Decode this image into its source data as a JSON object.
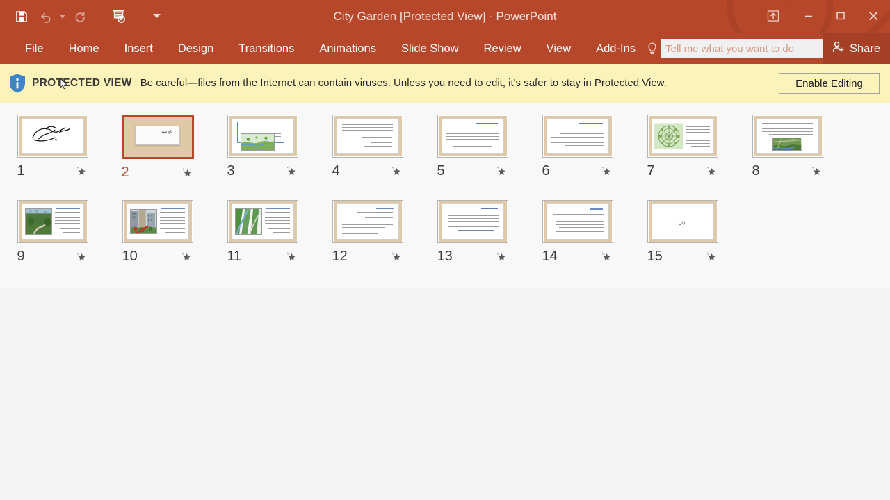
{
  "window": {
    "title": "City Garden [Protected View] - PowerPoint",
    "accent_color": "#b7472a",
    "share_bg": "#a53f25"
  },
  "quick_access": {
    "items": [
      {
        "name": "save-icon",
        "label": "Save"
      },
      {
        "name": "undo-icon",
        "label": "Undo"
      },
      {
        "name": "undo-dropdown-icon",
        "label": "Undo options"
      },
      {
        "name": "redo-icon",
        "label": "Redo"
      },
      {
        "name": "start-presentation-icon",
        "label": "Start From Beginning"
      },
      {
        "name": "customize-qat-icon",
        "label": "Customize Quick Access Toolbar"
      }
    ]
  },
  "window_controls": {
    "ribbon_display_options": "Ribbon Display Options",
    "minimize": "Minimize",
    "restore": "Restore Down",
    "close": "Close"
  },
  "ribbon": {
    "tabs": [
      {
        "label": "File"
      },
      {
        "label": "Home"
      },
      {
        "label": "Insert"
      },
      {
        "label": "Design"
      },
      {
        "label": "Transitions"
      },
      {
        "label": "Animations"
      },
      {
        "label": "Slide Show"
      },
      {
        "label": "Review"
      },
      {
        "label": "View"
      },
      {
        "label": "Add-Ins"
      }
    ],
    "tell_me": {
      "value": "",
      "placeholder": "Tell me what you want to do"
    },
    "share_label": "Share"
  },
  "protected_view": {
    "badge": "PROTECTED VIEW",
    "message": "Be careful—files from the Internet can contain viruses. Unless you need to edit, it's safer to stay in Protected View.",
    "enable_button": "Enable Editing",
    "bar_color": "#fcf3ba",
    "shield_color": "#3d85c8"
  },
  "slide_sorter": {
    "selected_slide": 2,
    "slides": [
      {
        "number": "1",
        "kind": "calligraphy",
        "has_animation": true
      },
      {
        "number": "2",
        "kind": "title",
        "title": "باغ شهر",
        "has_animation": true
      },
      {
        "number": "3",
        "kind": "text-image-overlay",
        "has_animation": true
      },
      {
        "number": "4",
        "kind": "text",
        "has_animation": true
      },
      {
        "number": "5",
        "kind": "text",
        "has_animation": true
      },
      {
        "number": "6",
        "kind": "text",
        "has_animation": true
      },
      {
        "number": "7",
        "kind": "image-left-text-right",
        "has_animation": true
      },
      {
        "number": "8",
        "kind": "text-image-bottom",
        "has_animation": true
      },
      {
        "number": "9",
        "kind": "image-left-text-right",
        "has_animation": true
      },
      {
        "number": "10",
        "kind": "image-left-text-right",
        "has_animation": true
      },
      {
        "number": "11",
        "kind": "image-left-text-right",
        "has_animation": true
      },
      {
        "number": "12",
        "kind": "text",
        "has_animation": true
      },
      {
        "number": "13",
        "kind": "text",
        "has_animation": true
      },
      {
        "number": "14",
        "kind": "text",
        "has_animation": true
      },
      {
        "number": "15",
        "kind": "end",
        "title": "پایان",
        "has_animation": true
      }
    ]
  }
}
